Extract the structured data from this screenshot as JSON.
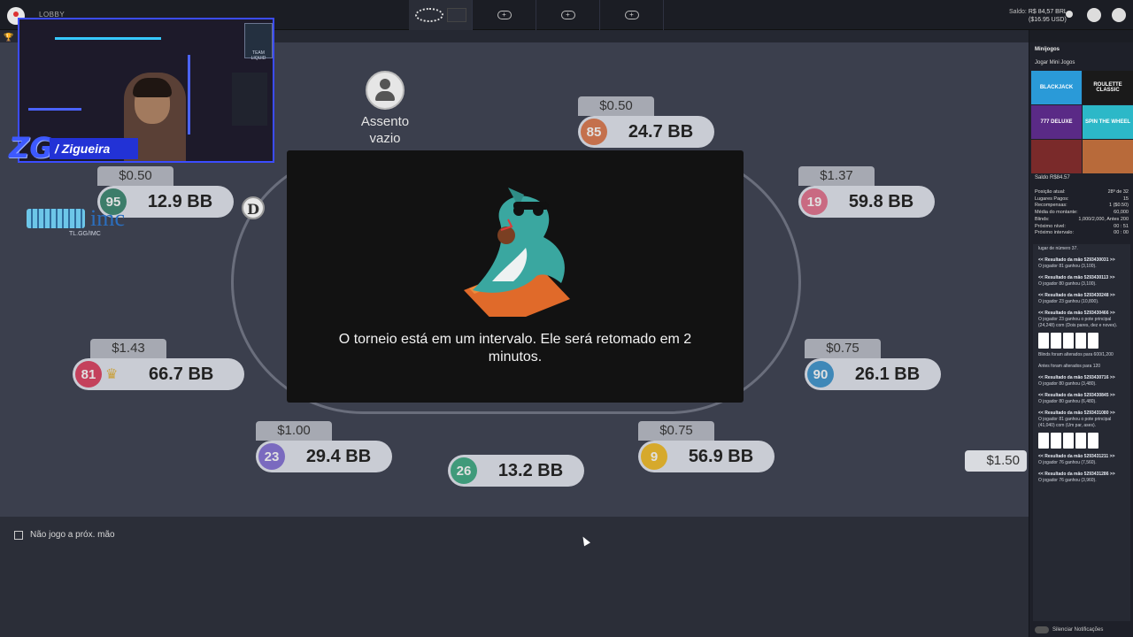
{
  "topbar": {
    "lobby": "LOBBY",
    "balance_label": "Saldo:",
    "balance_brl": "R$ 84,57 BRL",
    "balance_usd": "($16.95 USD)"
  },
  "webcam": {
    "team": "TEAM LIQUID",
    "streamer": "/ Zigueira",
    "logo": "ZG"
  },
  "sponsor": {
    "name": "imc",
    "url": "TL.GG/IMC"
  },
  "table": {
    "empty_seat": "Assento vazio",
    "dealer": "D",
    "pot": "$1.50",
    "seats": [
      {
        "num": "95",
        "stack": "12.9 BB",
        "bet": "$0.50",
        "color": "#3c7d6a"
      },
      {
        "num": "85",
        "stack": "24.7 BB",
        "bet": "$0.50",
        "color": "#c4704c"
      },
      {
        "num": "19",
        "stack": "59.8 BB",
        "bet": "$1.37",
        "color": "#c96a82"
      },
      {
        "num": "81",
        "stack": "66.7 BB",
        "bet": "$1.43",
        "color": "#c4415c"
      },
      {
        "num": "90",
        "stack": "26.1 BB",
        "bet": "$0.75",
        "color": "#3f88b8"
      },
      {
        "num": "23",
        "stack": "29.4 BB",
        "bet": "$1.00",
        "color": "#7a6abf"
      },
      {
        "num": "26",
        "stack": "13.2 BB",
        "bet": "",
        "color": "#3f9a7a"
      },
      {
        "num": "9",
        "stack": "56.9 BB",
        "bet": "$0.75",
        "color": "#d6a92c"
      }
    ]
  },
  "modal": {
    "message": "O torneio está em um intervalo. Ele será retomado em 2 minutos."
  },
  "bottom": {
    "not_play": "Não jogo a próx. mão"
  },
  "sidebar": {
    "title": "Minijogos",
    "play": "Jogar Mini Jogos",
    "tiles": [
      "BLACKJACK",
      "ROULETTE CLASSIC",
      "777 DELUXE",
      "SPIN THE WHEEL",
      "",
      ""
    ],
    "saldo": "Saldo  R$84.57",
    "stats": [
      {
        "k": "Posição atual:",
        "v": "28º de 32"
      },
      {
        "k": "Lugares Pagos:",
        "v": "15"
      },
      {
        "k": "Recompensas:",
        "v": "1 ($0.50)"
      },
      {
        "k": "Média do montante:",
        "v": "60,000"
      },
      {
        "k": "Blinds:",
        "v": "1,000/2,000, Antes 200"
      },
      {
        "k": "Próximo nível:",
        "v": "00 : 51"
      },
      {
        "k": "Próximo intervalo:",
        "v": "00 : 00"
      }
    ],
    "log": {
      "l0": "lugar de número 37.",
      "h1": "<< Resultado da mão 5293430031 >>",
      "p1": "O jogador 81 ganhou (3,100).",
      "h2": "<< Resultado da mão 5293430113 >>",
      "p2": "O jogador 80 ganhou (3,100).",
      "h3": "<< Resultado da mão 5293430248 >>",
      "p3": "O jogador 23 ganhou (10,800).",
      "h4": "<< Resultado da mão 5293430466 >>",
      "p4": "O jogador 23 ganhou o pote principal (24,248) com (Dois pares, dez e noves).",
      "b1": "Blinds foram alterados para 600/1,200",
      "b2": "Antes foram alterados para 120",
      "h5": "<< Resultado da mão 5293430716 >>",
      "p5": "O jogador 80 ganhou (3,480).",
      "h6": "<< Resultado da mão 5293430845 >>",
      "p6": "O jogador 80 ganhou (6,480).",
      "h7": "<< Resultado da mão 5293431080 >>",
      "p7": "O jogador 81 ganhou o pote principal (41,040) com (Um par, ases).",
      "h8": "<< Resultado da mão 5293431211 >>",
      "p8": "O jogador 76 ganhou (7,560).",
      "h9": "<< Resultado da mão 5293431286 >>",
      "p9": "O jogador 76 ganhou (3,960)."
    },
    "silence": "Silenciar Notificações"
  }
}
